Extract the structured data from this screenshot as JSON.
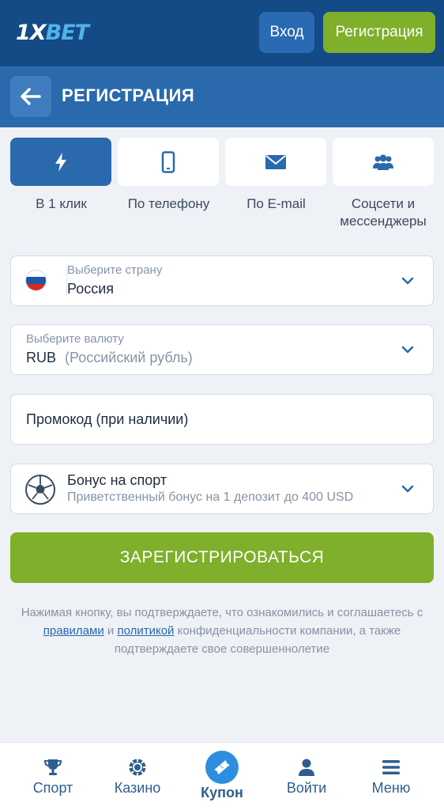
{
  "topbar": {
    "logo_main": "1X",
    "logo_accent": "BET",
    "login_label": "Вход",
    "register_label": "Регистрация"
  },
  "header": {
    "title": "РЕГИСТРАЦИЯ",
    "back_icon": "arrow-left-icon"
  },
  "methods": [
    {
      "label": "В 1 клик",
      "icon": "lightning-icon",
      "active": true
    },
    {
      "label": "По телефону",
      "icon": "phone-icon",
      "active": false
    },
    {
      "label": "По E-mail",
      "icon": "envelope-icon",
      "active": false
    },
    {
      "label": "Соцсети и мессенджеры",
      "icon": "users-icon",
      "active": false
    }
  ],
  "country": {
    "caption": "Выберите страну",
    "value": "Россия",
    "flag": "russia-flag-icon"
  },
  "currency": {
    "caption": "Выберите валюту",
    "code": "RUB",
    "name": "(Российский рубль)"
  },
  "promo": {
    "placeholder": "Промокод (при наличии)"
  },
  "bonus": {
    "title": "Бонус на спорт",
    "description": "Приветственный бонус на 1 депозит до 400 USD",
    "icon": "soccer-ball-icon"
  },
  "submit_label": "ЗАРЕГИСТРИРОВАТЬСЯ",
  "terms": {
    "part1": "Нажимая кнопку, вы подтверждаете, что ознакомились и соглашаетесь с",
    "rules_link": "правилами",
    "and": "и",
    "policy_link": "политикой",
    "part2": "конфиденциальности компании, а также подтверждаете свое совершеннолетие"
  },
  "bottom_nav": [
    {
      "label": "Спорт",
      "icon": "trophy-icon"
    },
    {
      "label": "Казино",
      "icon": "casino-chip-icon"
    },
    {
      "label": "Купон",
      "icon": "ticket-icon"
    },
    {
      "label": "Войти",
      "icon": "user-icon"
    },
    {
      "label": "Меню",
      "icon": "menu-icon"
    }
  ],
  "colors": {
    "topbar": "#144a85",
    "header": "#2a69ac",
    "accent_green": "#7faf2b",
    "nav_text": "#2f5d8f",
    "coupon_blue": "#2d8ee0"
  }
}
